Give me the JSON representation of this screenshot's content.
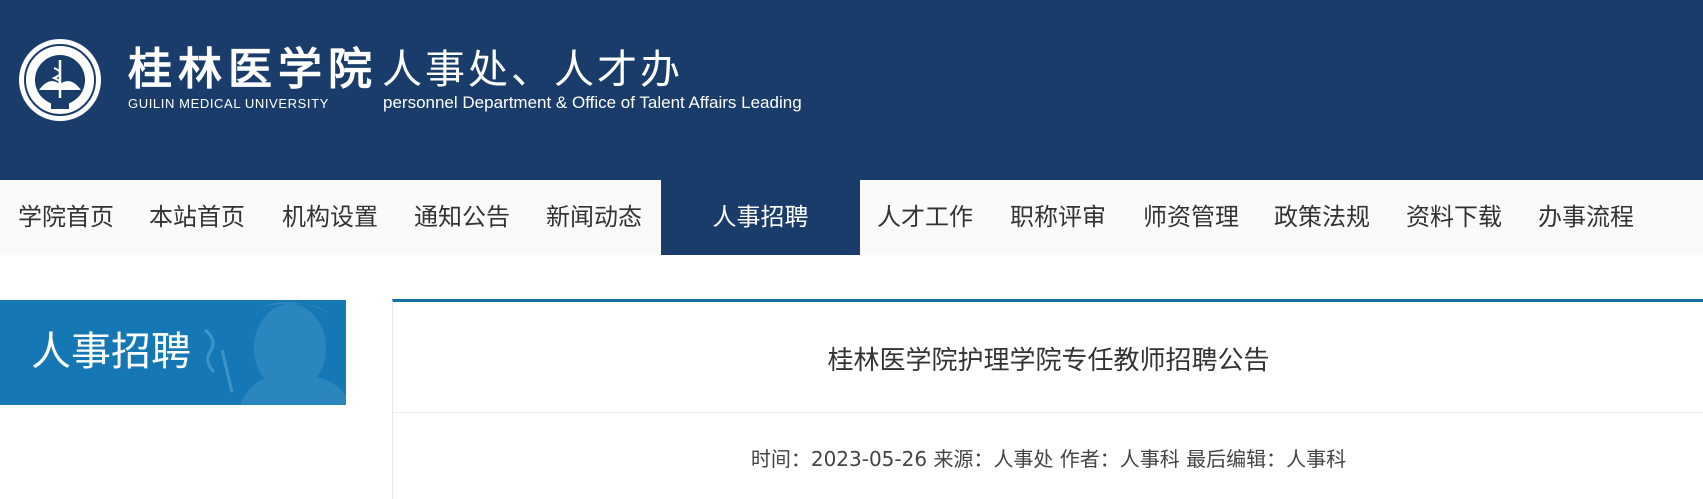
{
  "header": {
    "school_name_cn": "桂林医学院",
    "school_name_en": "GUILIN MEDICAL UNIVERSITY",
    "dept_name_cn": "人事处、人才办",
    "dept_name_en": "personnel Department & Office of Talent Affairs Leading",
    "seal_icon": "university-seal-icon",
    "colors": {
      "header_bg": "#1a3c6a",
      "accent": "#1578b4",
      "text_light": "#ffffff"
    }
  },
  "nav": {
    "items": [
      {
        "label": "学院首页"
      },
      {
        "label": "本站首页"
      },
      {
        "label": "机构设置"
      },
      {
        "label": "通知公告"
      },
      {
        "label": "新闻动态"
      },
      {
        "label": "人事招聘",
        "active": true
      },
      {
        "label": "人才工作"
      },
      {
        "label": "职称评审"
      },
      {
        "label": "师资管理"
      },
      {
        "label": "政策法规"
      },
      {
        "label": "资料下载"
      },
      {
        "label": "办事流程"
      }
    ]
  },
  "sidebar": {
    "title": "人事招聘"
  },
  "article": {
    "title": "桂林医学院护理学院专任教师招聘公告",
    "meta": {
      "time_label": "时间：",
      "time": "2023-05-26",
      "source_label": "来源：",
      "source": "人事处",
      "author_label": "作者：",
      "author": "人事科",
      "editor_label": "最后编辑：",
      "editor": "人事科"
    }
  }
}
